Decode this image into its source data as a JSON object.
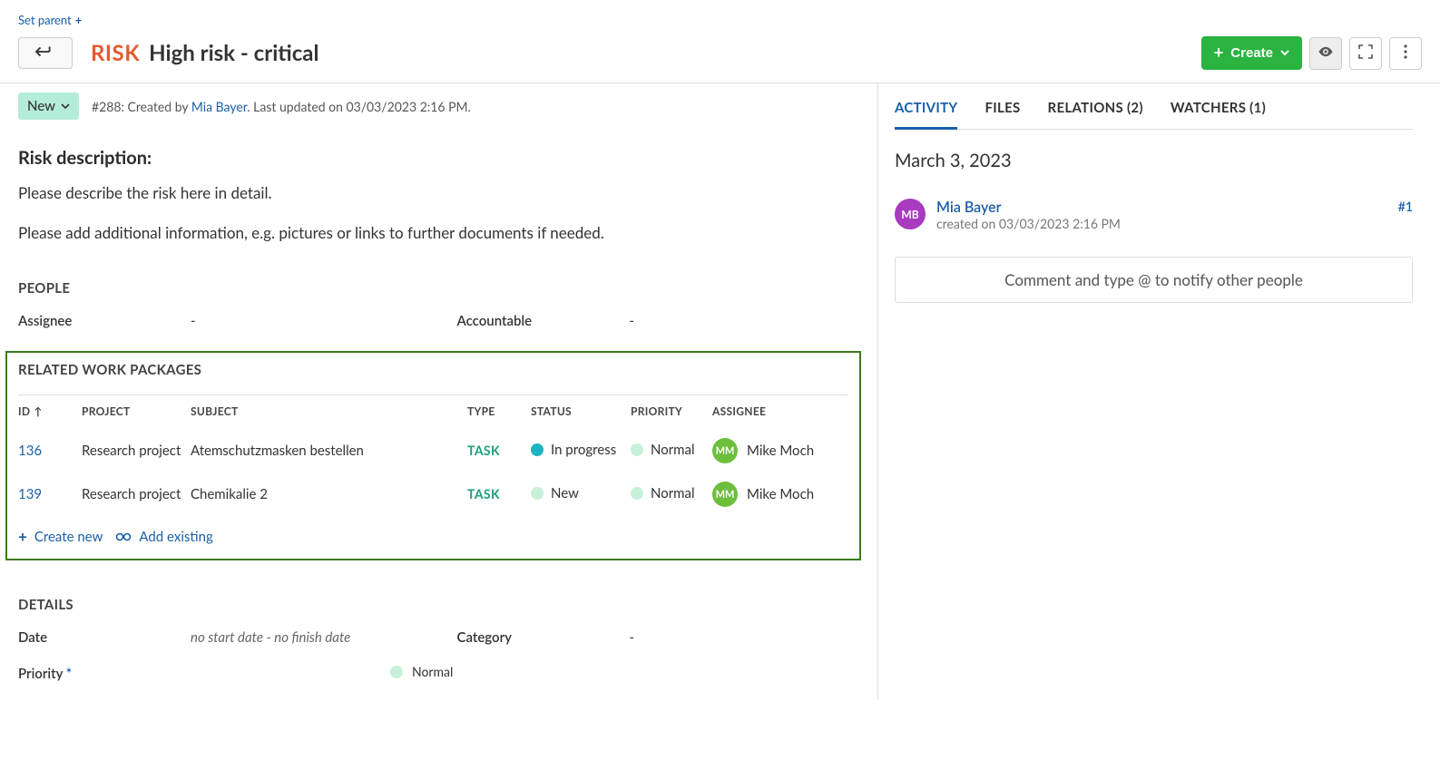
{
  "top": {
    "set_parent": "Set parent"
  },
  "header": {
    "type": "RISK",
    "title": "High risk - critical",
    "create": "Create"
  },
  "meta": {
    "status": "New",
    "id_prefix": "#288: Created by ",
    "user": "Mia Bayer",
    "suffix": ". Last updated on 03/03/2023 2:16 PM."
  },
  "description": {
    "heading": "Risk description:",
    "p1": "Please describe the risk here in detail.",
    "p2": "Please add additional information, e.g. pictures or links to further documents if needed."
  },
  "people": {
    "section": "PEOPLE",
    "assignee_label": "Assignee",
    "assignee_value": "-",
    "accountable_label": "Accountable",
    "accountable_value": "-"
  },
  "related": {
    "section": "RELATED WORK PACKAGES",
    "headers": {
      "id": "ID",
      "project": "PROJECT",
      "subject": "SUBJECT",
      "type": "TYPE",
      "status": "STATUS",
      "priority": "PRIORITY",
      "assignee": "ASSIGNEE"
    },
    "rows": [
      {
        "id": "136",
        "project": "Research project",
        "subject": "Atemschutzmasken bestellen",
        "type": "TASK",
        "status": "In progress",
        "status_color": "teal",
        "priority": "Normal",
        "assignee_initials": "MM",
        "assignee": "Mike Moch"
      },
      {
        "id": "139",
        "project": "Research project",
        "subject": "Chemikalie 2",
        "type": "TASK",
        "status": "New",
        "status_color": "lightgreen",
        "priority": "Normal",
        "assignee_initials": "MM",
        "assignee": "Mike Moch"
      }
    ],
    "create_new": "Create new",
    "add_existing": "Add existing"
  },
  "details": {
    "section": "DETAILS",
    "date_label": "Date",
    "date_value": "no start date - no finish date",
    "category_label": "Category",
    "category_value": "-",
    "priority_label": "Priority",
    "priority_value": "Normal"
  },
  "tabs": {
    "activity": "ACTIVITY",
    "files": "FILES",
    "relations": "RELATIONS (2)",
    "watchers": "WATCHERS (1)"
  },
  "activity": {
    "date": "March 3, 2023",
    "user_initials": "MB",
    "user": "Mia Bayer",
    "meta": "created on 03/03/2023 2:16 PM",
    "number": "#1"
  },
  "comment_placeholder": "Comment and type @ to notify other people"
}
